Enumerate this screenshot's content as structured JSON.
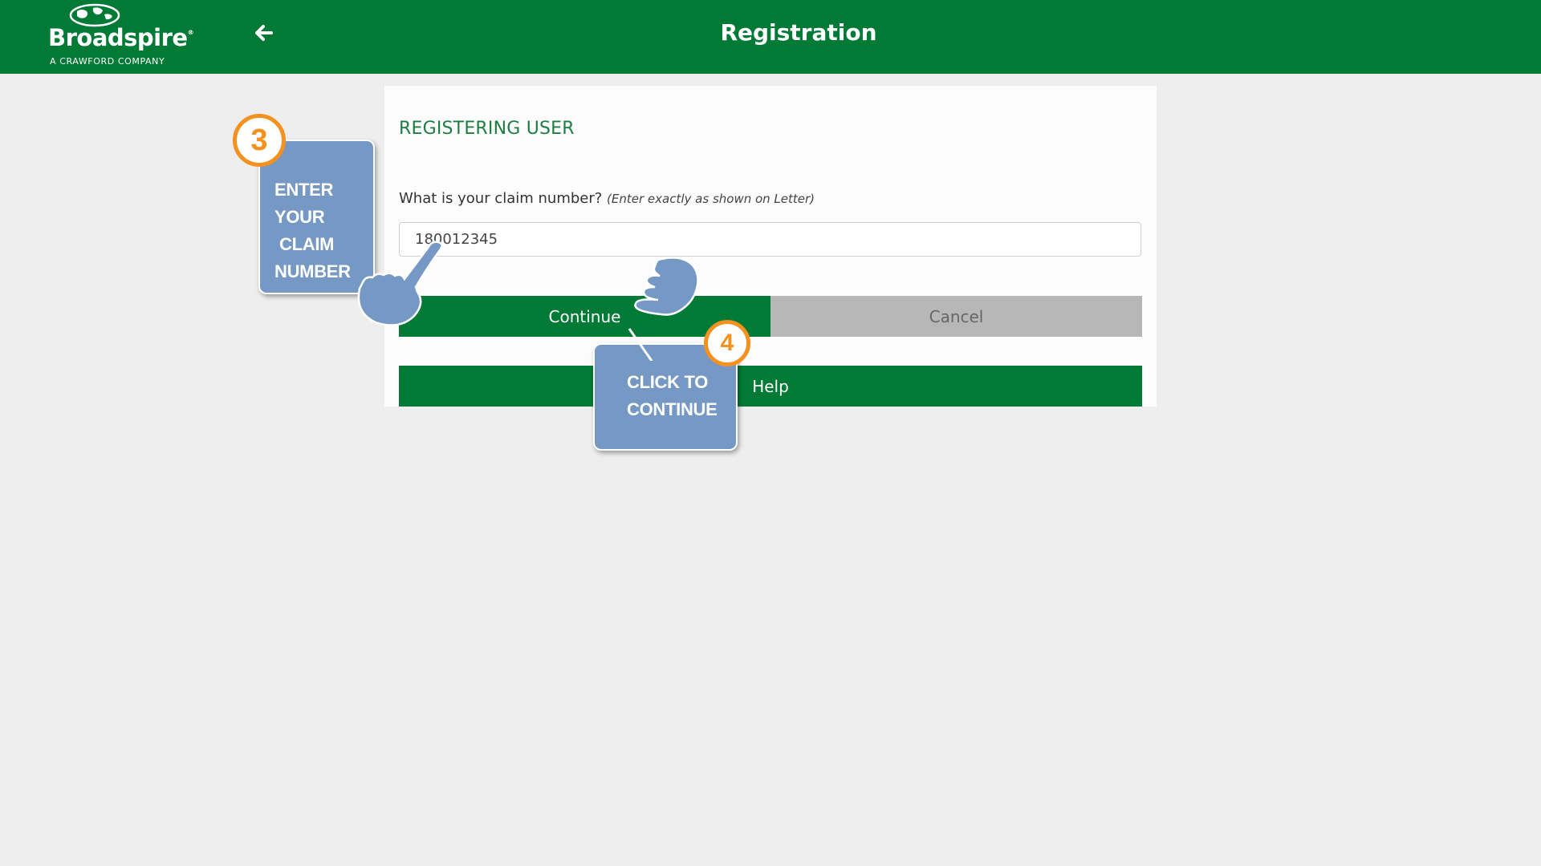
{
  "header": {
    "brand_name": "Broadspire",
    "brand_tagline": "A CRAWFORD COMPANY",
    "title": "Registration",
    "back_icon": "arrow-left-icon",
    "background_color": "#007a35"
  },
  "form": {
    "heading": "REGISTERING USER",
    "claim_question": "What is your claim number?",
    "claim_hint": "(Enter exactly as shown on Letter)",
    "claim_value": "180012345"
  },
  "buttons": {
    "continue_label": "Continue",
    "cancel_label": "Cancel",
    "help_label": "Help"
  },
  "annotations": {
    "step3": {
      "number": "3",
      "lines": [
        "ENTER YOUR",
        "CLAIM",
        "NUMBER"
      ]
    },
    "step4": {
      "number": "4",
      "lines": [
        "CLICK TO",
        "CONTINUE"
      ]
    },
    "callout_color": "#7598c5",
    "badge_color": "#f5911e"
  }
}
